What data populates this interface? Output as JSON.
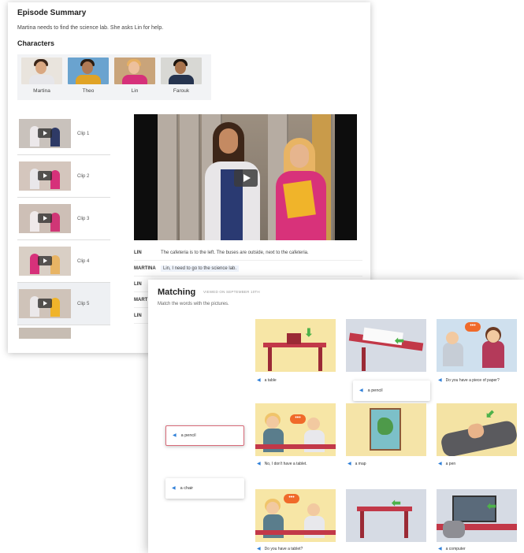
{
  "episode": {
    "title": "Episode Summary",
    "description": "Martina needs to find the science lab. She asks Lin for help.",
    "characters_title": "Characters",
    "characters": [
      {
        "name": "Martina"
      },
      {
        "name": "Theo"
      },
      {
        "name": "Lin"
      },
      {
        "name": "Farouk"
      }
    ],
    "clips": [
      {
        "label": "Clip 1"
      },
      {
        "label": "Clip 2"
      },
      {
        "label": "Clip 3"
      },
      {
        "label": "Clip 4"
      },
      {
        "label": "Clip 5"
      }
    ],
    "transcript": [
      {
        "speaker": "LIN",
        "line": "The cafeteria is to the left. The buses are outside, next to the cafeteria."
      },
      {
        "speaker": "MARTINA",
        "line": "Lin, I need to go to the science lab."
      },
      {
        "speaker": "LIN",
        "line": ""
      },
      {
        "speaker": "MART",
        "line": ""
      },
      {
        "speaker": "LIN",
        "line": ""
      }
    ]
  },
  "matching": {
    "title": "Matching",
    "viewed": "VIEWED ON SEPTEMBER 10TH",
    "instructions": "Match the words with the pictures.",
    "captions": [
      "a table",
      "Do you have a piece of paper?",
      "No, I don't have a tablet.",
      "a map",
      "a pen",
      "Do you have a tablet?",
      "a computer"
    ],
    "word_cards": [
      "a pencil",
      "a pencil",
      "a chair"
    ]
  }
}
